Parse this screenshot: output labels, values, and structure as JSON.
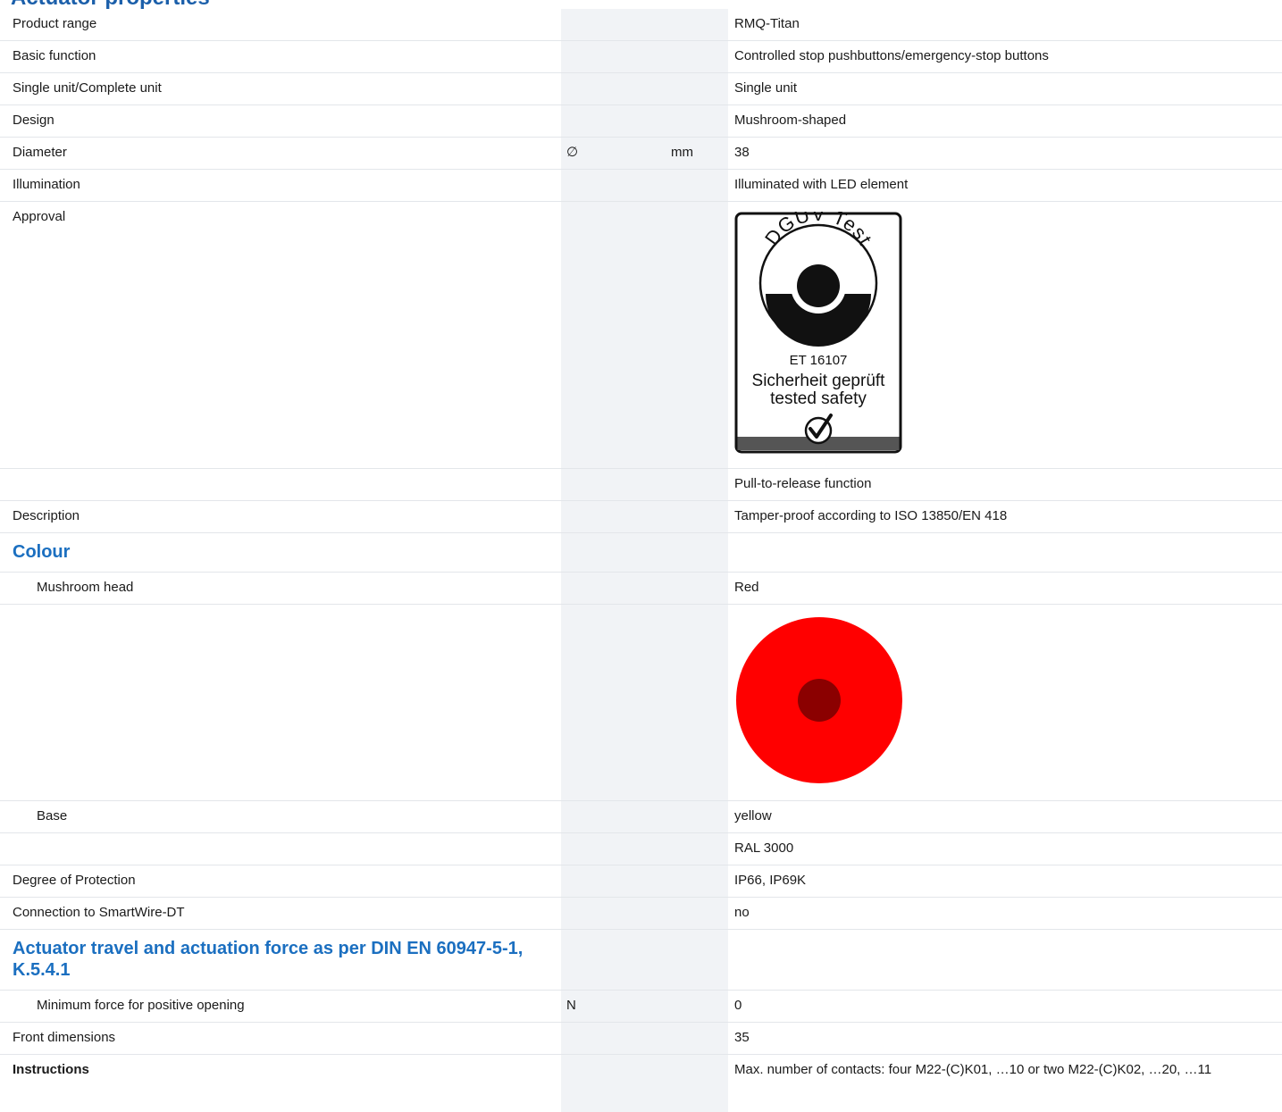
{
  "page_heading": "Actuator properties",
  "rows": {
    "product_range": {
      "label": "Product range",
      "value": "RMQ-Titan"
    },
    "basic_function": {
      "label": "Basic function",
      "value": "Controlled stop pushbuttons/emergency-stop buttons"
    },
    "single_unit": {
      "label": "Single unit/Complete unit",
      "value": "Single unit"
    },
    "design": {
      "label": "Design",
      "value": "Mushroom-shaped"
    },
    "diameter": {
      "label": "Diameter",
      "symbol": "∅",
      "unit": "mm",
      "value": "38"
    },
    "illumination": {
      "label": "Illumination",
      "value": "Illuminated with LED element"
    },
    "approval": {
      "label": "Approval"
    },
    "pull_release": {
      "value": "Pull-to-release function"
    },
    "description": {
      "label": "Description",
      "value": "Tamper-proof according to ISO 13850/EN 418"
    },
    "mushroom_head": {
      "label": "Mushroom head",
      "value": "Red"
    },
    "base": {
      "label": "Base",
      "value": "yellow"
    },
    "ral": {
      "value": "RAL 3000"
    },
    "protection": {
      "label": "Degree of Protection",
      "value": "IP66, IP69K"
    },
    "smartwire": {
      "label": "Connection to SmartWire-DT",
      "value": "no"
    },
    "min_force": {
      "label": "Minimum force for positive opening",
      "unit": "N",
      "value": "0"
    },
    "front_dimensions": {
      "label": "Front dimensions",
      "value": "35"
    },
    "instructions": {
      "label": "Instructions",
      "value": "Max. number of contacts: four M22-(C)K01, …10 or two M22-(C)K02, …20, …11"
    }
  },
  "sections": {
    "colour": "Colour",
    "actuator_travel": "Actuator travel and actuation force as per DIN EN 60947-5-1, K.5.4.1"
  },
  "dguv_badge": {
    "ring_text": "DGUV Test",
    "cert_number": "ET 16107",
    "line1": "Sicherheit geprüft",
    "line2": "tested safety"
  },
  "colors": {
    "heading_blue": "#1b5faa",
    "mushroom_red": "#ff0000",
    "center_dark_red": "#8b0000",
    "grey_column": "#f1f3f6"
  }
}
